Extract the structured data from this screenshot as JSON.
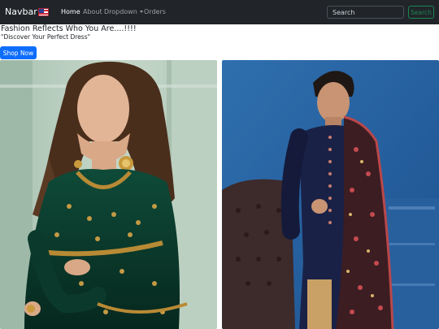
{
  "navbar": {
    "brand": "Navbar",
    "items": [
      {
        "label": "Home",
        "active": true
      },
      {
        "label": "About",
        "active": false
      },
      {
        "label": "Dropdown",
        "active": false,
        "dropdown": true
      },
      {
        "label": "Orders",
        "active": false
      }
    ],
    "search_placeholder": "Search",
    "search_button": "Search",
    "flag_icon": "flag-icon"
  },
  "hero": {
    "headline": "Fashion Reflects Who You Are....!!!!",
    "subline": "\"Discover Your Perfect Dress\"",
    "cta": "Shop Now"
  },
  "colors": {
    "navbar_bg": "#212529",
    "primary": "#0d6efd",
    "success": "#198754"
  },
  "products": [
    {
      "image": "woman-green-embroidered-anarkali-dress"
    },
    {
      "image": "man-navy-sherwani-with-embroidered-shawl"
    }
  ]
}
